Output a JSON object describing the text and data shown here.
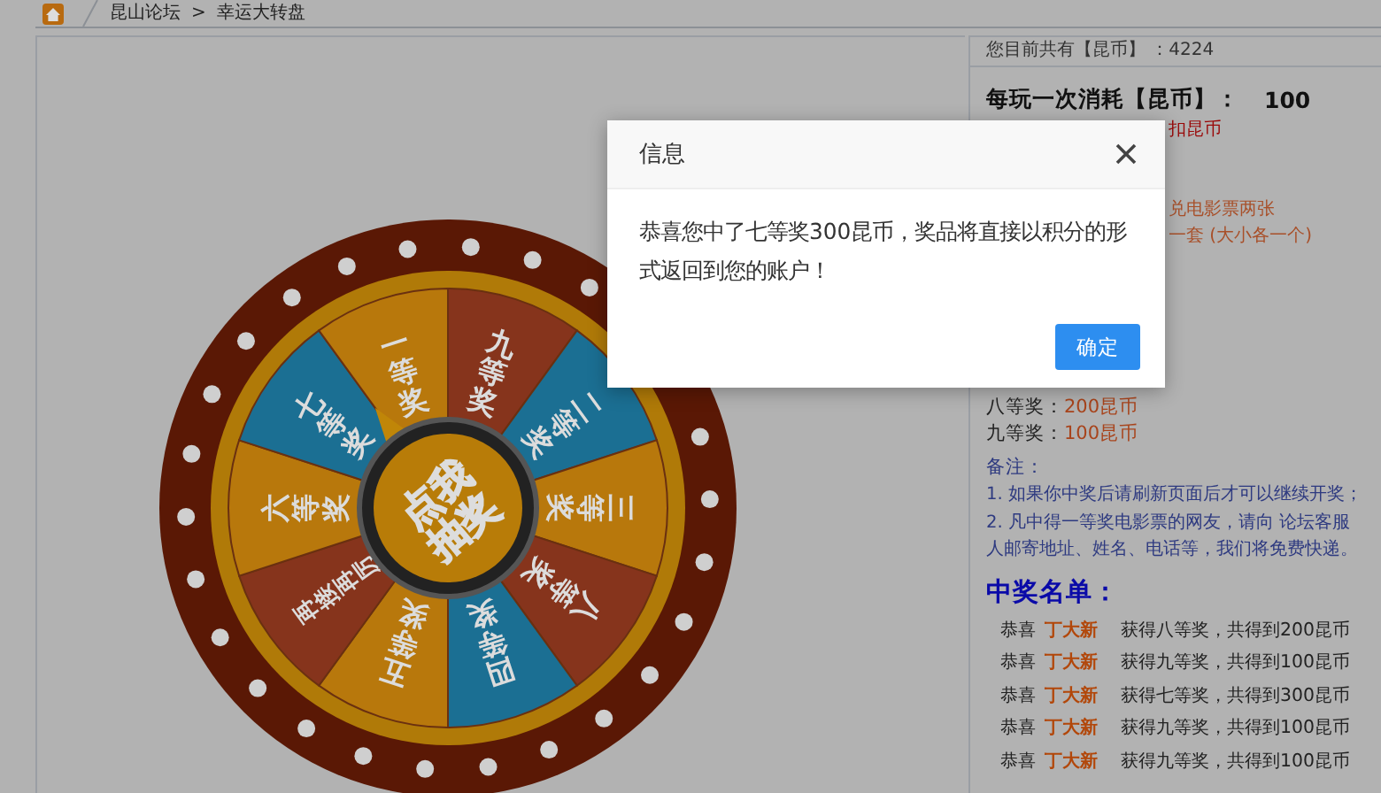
{
  "breadcrumb": {
    "items": [
      "昆山论坛",
      "幸运大转盘"
    ],
    "separator": ">"
  },
  "wheel": {
    "segments": [
      {
        "label": "九等奖",
        "color": "#86341c"
      },
      {
        "label": "二等奖",
        "color": "#1b6f93"
      },
      {
        "label": "三等奖",
        "color": "#b8780c"
      },
      {
        "label": "八等奖",
        "color": "#86341c"
      },
      {
        "label": "四等奖",
        "color": "#1b6f93"
      },
      {
        "label": "五等奖",
        "color": "#b8780c"
      },
      {
        "label": "再接再厉",
        "color": "#86341c"
      },
      {
        "label": "六等奖",
        "color": "#b8780c"
      },
      {
        "label": "七等奖",
        "color": "#1b6f93"
      },
      {
        "label": "一等奖",
        "color": "#b8780c"
      }
    ],
    "center_label": "点我抽奖"
  },
  "sidebar": {
    "balance": "您目前共有【昆币】 ：4224",
    "cost_label": "每玩一次消耗【昆币】：",
    "cost_value": "100",
    "partial_lines": [
      {
        "text": "扣昆币",
        "kind": "red"
      },
      {
        "text": "兑电影票两张",
        "kind": "orange"
      },
      {
        "text": "一套 (大小各一个)",
        "kind": "orange"
      }
    ],
    "prizes": [
      {
        "name": "八等奖：",
        "value": "200昆币"
      },
      {
        "name": "九等奖：",
        "value": "100昆币"
      }
    ],
    "notes_title": "备注：",
    "notes": [
      "1. 如果你中奖后请刷新页面后才可以继续开奖；",
      "2. 凡中得一等奖电影票的网友，请向 论坛客服",
      "人邮寄地址、姓名、电话等，我们将免费快递。"
    ],
    "winners_title": "中奖名单：",
    "winners": [
      {
        "prefix": "恭喜",
        "name": "丁大新",
        "result": "获得八等奖，共得到200昆币"
      },
      {
        "prefix": "恭喜",
        "name": "丁大新",
        "result": "获得九等奖，共得到100昆币"
      },
      {
        "prefix": "恭喜",
        "name": "丁大新",
        "result": "获得七等奖，共得到300昆币"
      },
      {
        "prefix": "恭喜",
        "name": "丁大新",
        "result": "获得九等奖，共得到100昆币"
      },
      {
        "prefix": "恭喜",
        "name": "丁大新",
        "result": "获得九等奖，共得到100昆币"
      }
    ]
  },
  "dialog": {
    "title": "信息",
    "message": "恭喜您中了七等奖300昆币，奖品将直接以积分的形式返回到您的账户！",
    "confirm": "确定"
  }
}
